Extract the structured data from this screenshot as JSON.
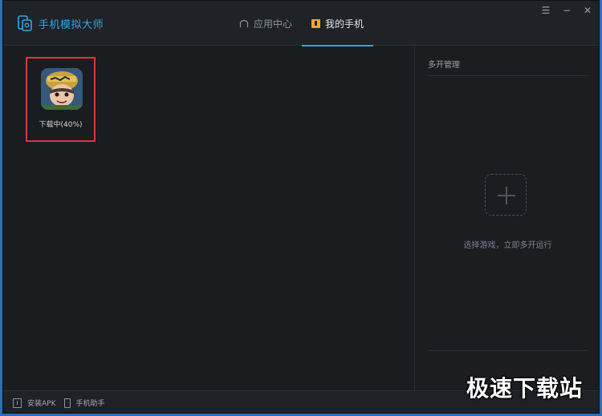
{
  "app": {
    "title": "手机模拟大师"
  },
  "tabs": [
    {
      "label": "应用中心",
      "icon": "home-icon",
      "active": false
    },
    {
      "label": "我的手机",
      "icon": "phone-icon",
      "active": true
    }
  ],
  "window_controls": {
    "menu": "☰",
    "minimize": "−",
    "close": "✕"
  },
  "my_phone": {
    "apps": [
      {
        "status": "下载中(40%)",
        "progress_percent": 40,
        "icon": "game-character-icon"
      }
    ]
  },
  "multi_open": {
    "title": "多开管理",
    "hint": "选择游戏，立即多开运行"
  },
  "footer": {
    "install_apk": "安装APK",
    "phone_assistant": "手机助手"
  },
  "watermark": "极速下载站",
  "colors": {
    "accent": "#2fa8e6",
    "highlight_border": "#d93737",
    "background": "#1a1c20"
  }
}
